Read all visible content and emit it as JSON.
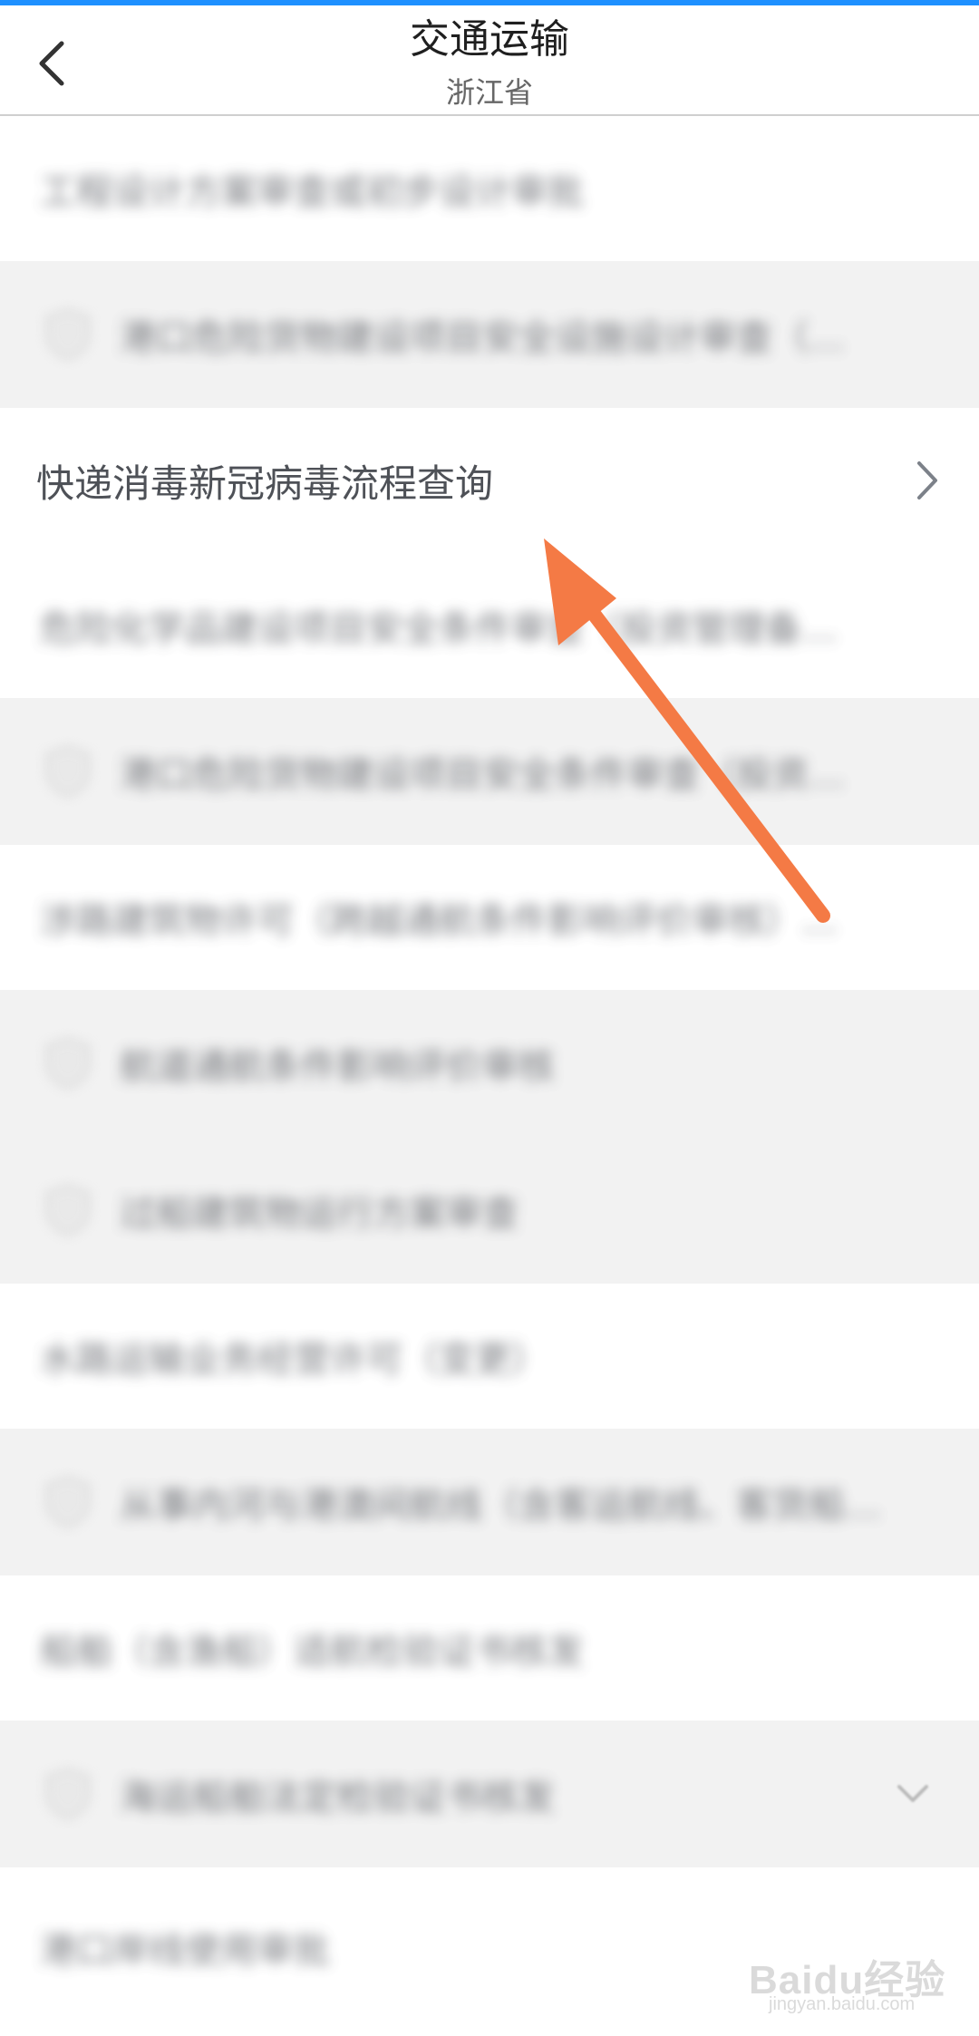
{
  "header": {
    "title": "交通运输",
    "subtitle": "浙江省"
  },
  "list": [
    {
      "label": "工程设计方案审查或初步设计审批",
      "style": "white",
      "indent": false,
      "blurred": true
    },
    {
      "label": "港口危险货物建设项目安全设施设计审查（…",
      "style": "grey",
      "indent": true,
      "blurred": true
    },
    {
      "label": "快递消毒新冠病毒流程查询",
      "style": "white",
      "indent": false,
      "blurred": false
    },
    {
      "label": "危险化学品建设项目安全条件审查（投资管理备…",
      "style": "white",
      "indent": false,
      "blurred": true
    },
    {
      "label": "港口危险货物建设项目安全条件审查（投资…",
      "style": "grey",
      "indent": true,
      "blurred": true
    },
    {
      "label": "涉路建筑物许可（跨越通航条件影响评价审核）…",
      "style": "white",
      "indent": false,
      "blurred": true
    },
    {
      "label": "航道通航条件影响评价审核",
      "style": "grey",
      "indent": true,
      "blurred": true
    },
    {
      "label": "过船建筑物运行方案审查",
      "style": "grey",
      "indent": true,
      "blurred": true
    },
    {
      "label": "水路运输业务经营许可（变更）",
      "style": "white",
      "indent": false,
      "blurred": true
    },
    {
      "label": "从事内河与港澳间航线（含客运航线、客货船…",
      "style": "grey",
      "indent": true,
      "blurred": true
    },
    {
      "label": "船舶（含渔船）适航检验证书核发",
      "style": "white",
      "indent": false,
      "blurred": true
    },
    {
      "label": "海运船舶法定检验证书核发",
      "style": "grey",
      "indent": true,
      "blurred": true
    },
    {
      "label": "港口岸线使用审批",
      "style": "white",
      "indent": false,
      "blurred": true
    }
  ],
  "icons": {
    "back": "chevron-left-icon",
    "row_arrow": "chevron-right-icon",
    "expand": "chevron-down-icon",
    "category": "shield-icon"
  },
  "colors": {
    "accent_bar": "#1e90ff",
    "annotation_arrow": "#f47a45",
    "row_grey": "#f2f2f2"
  },
  "watermark": {
    "logo": "Baidu经验",
    "url": "jingyan.baidu.com"
  }
}
